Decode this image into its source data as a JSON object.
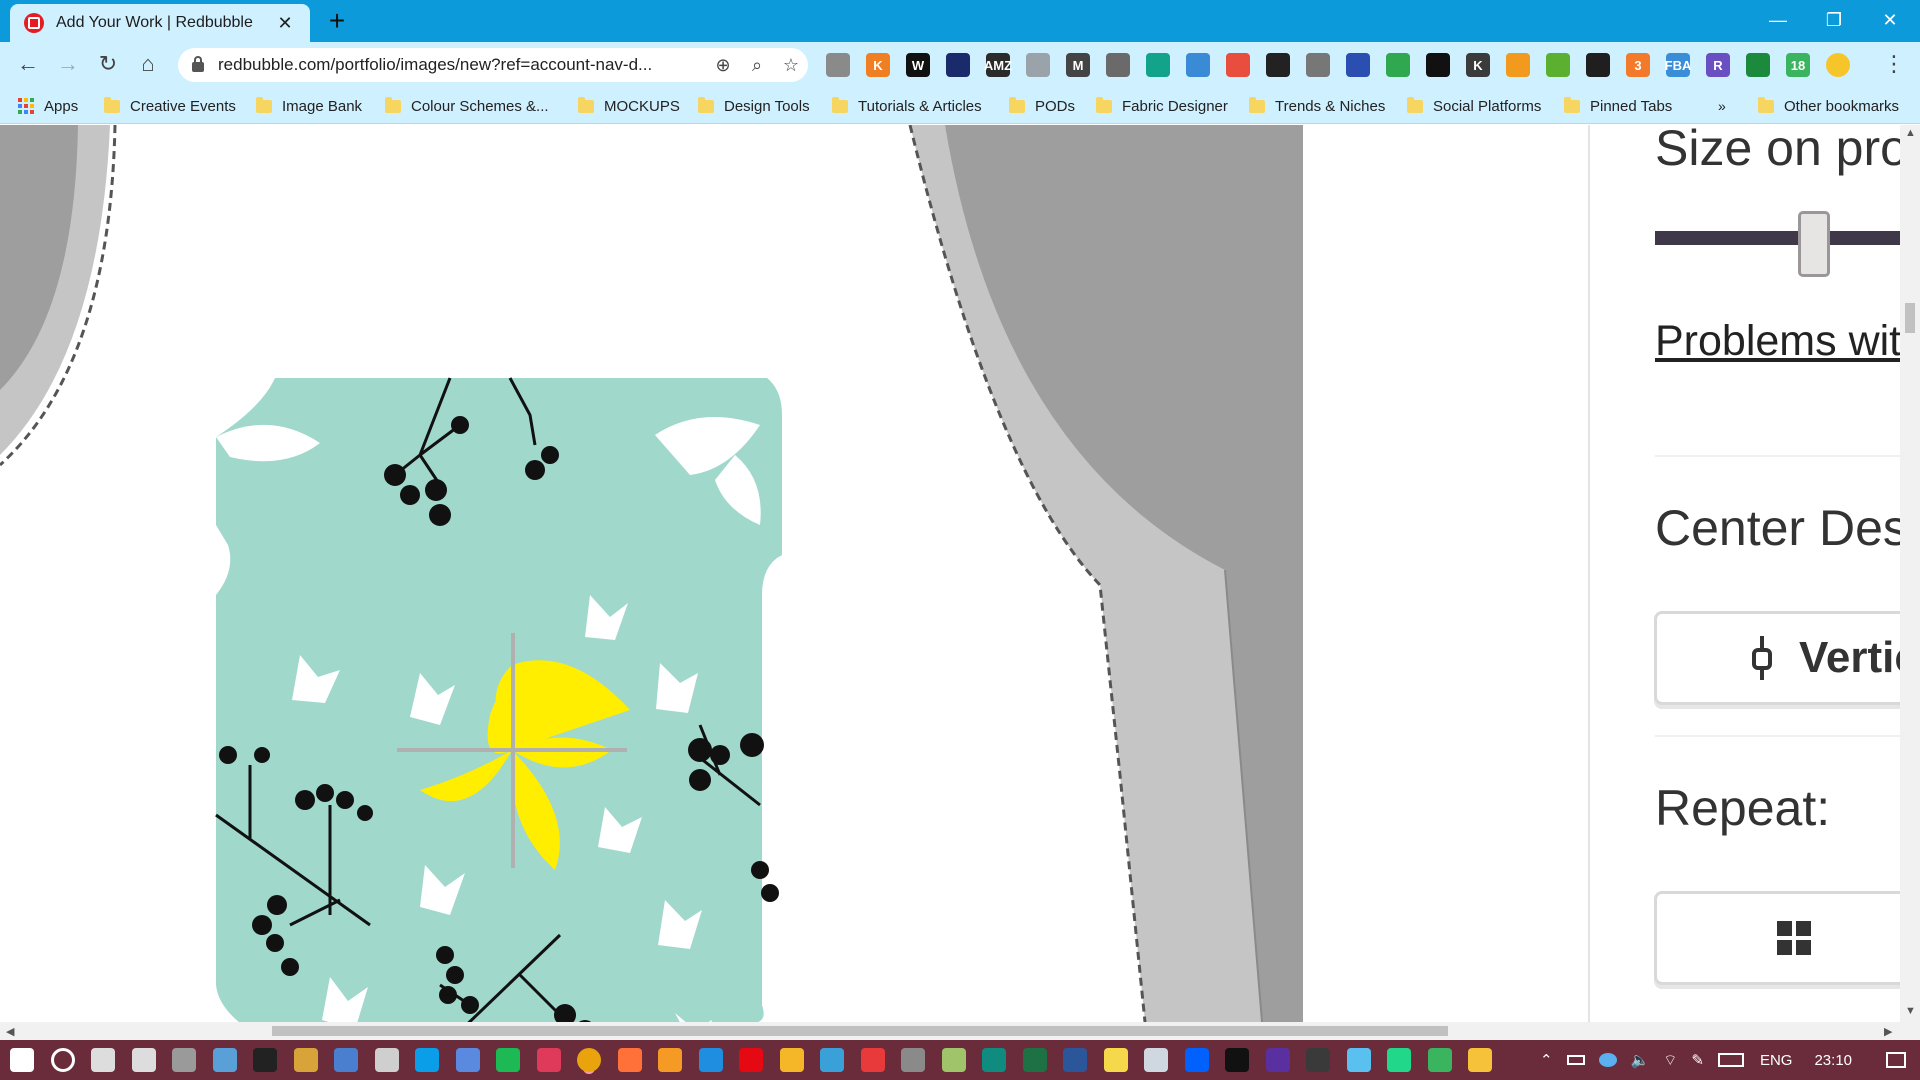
{
  "browser": {
    "tab": {
      "title": "Add Your Work | Redbubble",
      "close": "✕"
    },
    "new_tab": "+",
    "window_controls": {
      "minimize": "—",
      "restore": "❐",
      "close": "✕"
    },
    "nav": {
      "back": "←",
      "forward": "→",
      "reload": "↻",
      "home": "⌂"
    },
    "url": "redbubble.com/portfolio/images/new?ref=account-nav-d...",
    "omnibox_icons": [
      "translate-icon",
      "zoom-icon",
      "bookmark-star-icon"
    ],
    "extensions": [
      {
        "name": "ext-bubble",
        "label": "",
        "color": "#8a8a8a"
      },
      {
        "name": "ext-k",
        "label": "K",
        "color": "#f07f23"
      },
      {
        "name": "ext-w",
        "label": "W",
        "color": "#111111"
      },
      {
        "name": "ext-dark",
        "label": "",
        "color": "#1b2a6b"
      },
      {
        "name": "ext-amz",
        "label": "AMZ",
        "color": "#2b2b2b"
      },
      {
        "name": "ext-expand",
        "label": "",
        "color": "#9aa3aa"
      },
      {
        "name": "ext-m",
        "label": "M",
        "color": "#444444"
      },
      {
        "name": "ext-arrow",
        "label": "",
        "color": "#6a6a6a"
      },
      {
        "name": "ext-teal",
        "label": "",
        "color": "#12a38a"
      },
      {
        "name": "ext-doc",
        "label": "",
        "color": "#3a8ad6"
      },
      {
        "name": "ext-chart",
        "label": "",
        "color": "#e94d3d"
      },
      {
        "name": "ext-circle",
        "label": "",
        "color": "#222222"
      },
      {
        "name": "ext-bar",
        "label": "",
        "color": "#777777"
      },
      {
        "name": "ext-dropper",
        "label": "",
        "color": "#2a4fb0"
      },
      {
        "name": "ext-green-ring",
        "label": "",
        "color": "#2fa84f"
      },
      {
        "name": "ext-sync",
        "label": "",
        "color": "#111111"
      },
      {
        "name": "ext-k-dark",
        "label": "K",
        "color": "#3b3b3b"
      },
      {
        "name": "ext-key",
        "label": "",
        "color": "#f29a1e"
      },
      {
        "name": "ext-green",
        "label": "",
        "color": "#5cb030"
      },
      {
        "name": "ext-term",
        "label": "",
        "color": "#1f1f1f"
      },
      {
        "name": "ext-orange",
        "label": "3",
        "color": "#f27a2a"
      },
      {
        "name": "ext-fba",
        "label": "FBA",
        "color": "#3a8ed8"
      },
      {
        "name": "ext-r",
        "label": "R",
        "color": "#6a4fc2"
      },
      {
        "name": "ext-leaf",
        "label": "",
        "color": "#1c8a3c"
      },
      {
        "name": "ext-badge",
        "label": "18",
        "color": "#3ab45e"
      },
      {
        "name": "profile-avatar",
        "label": "",
        "color": "#f5c52a"
      }
    ],
    "menu": "⋮",
    "bookmarks_overflow": "»",
    "bookmarks": [
      {
        "label": "Apps",
        "type": "apps"
      },
      {
        "label": "Creative Events",
        "type": "folder"
      },
      {
        "label": "Image Bank",
        "type": "folder"
      },
      {
        "label": "Colour Schemes  &...",
        "type": "folder"
      },
      {
        "label": "MOCKUPS",
        "type": "folder"
      },
      {
        "label": "Design Tools",
        "type": "folder"
      },
      {
        "label": "Tutorials & Articles",
        "type": "folder"
      },
      {
        "label": "PODs",
        "type": "folder"
      },
      {
        "label": "Fabric Designer",
        "type": "folder"
      },
      {
        "label": "Trends & Niches",
        "type": "folder"
      },
      {
        "label": "Social Platforms",
        "type": "folder"
      },
      {
        "label": "Pinned Tabs",
        "type": "folder"
      },
      {
        "label": "Other bookmarks",
        "type": "folder"
      }
    ]
  },
  "editor_panel": {
    "size_heading": "Size on pro",
    "size_slider_value": 0.5,
    "problems_link": "Problems wit",
    "center_heading": "Center Des",
    "center_button": "Vertic",
    "repeat_heading": "Repeat:"
  },
  "colors": {
    "chrome_tabstrip": "#0c9ada",
    "chrome_toolbar": "#cff0ff",
    "design_bg": "#a0d8cc",
    "accent_yellow": "#ffee00",
    "taskbar": "#6a2c3b"
  },
  "taskbar": {
    "apps": [
      {
        "name": "windows-start-icon",
        "color": "#ffffff"
      },
      {
        "name": "cortana-icon",
        "color": "#ffffff"
      },
      {
        "name": "settings-icon",
        "color": "#dddddd"
      },
      {
        "name": "timer-icon",
        "color": "#dddddd"
      },
      {
        "name": "app-icon-1",
        "color": "#9a9a9a"
      },
      {
        "name": "app-icon-2",
        "color": "#5aa0d8"
      },
      {
        "name": "cmd-icon",
        "color": "#222222"
      },
      {
        "name": "app-icon-3",
        "color": "#d8a43a"
      },
      {
        "name": "app-icon-4",
        "color": "#4a7fd0"
      },
      {
        "name": "calculator-icon",
        "color": "#cfcfcf"
      },
      {
        "name": "skype-icon",
        "color": "#0a9ee8"
      },
      {
        "name": "app-icon-5",
        "color": "#5a8ae0"
      },
      {
        "name": "spotify-icon",
        "color": "#1db954"
      },
      {
        "name": "app-icon-6",
        "color": "#e03a5a"
      },
      {
        "name": "chrome-icon",
        "color": "#e8a30d"
      },
      {
        "name": "firefox-icon",
        "color": "#ff7139"
      },
      {
        "name": "app-icon-7",
        "color": "#f59a25"
      },
      {
        "name": "edge-icon",
        "color": "#1f8de0"
      },
      {
        "name": "netflix-icon",
        "color": "#e50914"
      },
      {
        "name": "app-icon-8",
        "color": "#f5b728"
      },
      {
        "name": "app-icon-9",
        "color": "#3aa0d8"
      },
      {
        "name": "app-icon-10",
        "color": "#e83a3a"
      },
      {
        "name": "app-icon-11",
        "color": "#8a8a8a"
      },
      {
        "name": "app-icon-12",
        "color": "#a0c46a"
      },
      {
        "name": "sway-icon",
        "color": "#0f8b7f"
      },
      {
        "name": "excel-icon",
        "color": "#1e7145"
      },
      {
        "name": "word-icon",
        "color": "#2b579a"
      },
      {
        "name": "sticky-notes-icon",
        "color": "#f5d94a"
      },
      {
        "name": "app-icon-13",
        "color": "#cfd8e0"
      },
      {
        "name": "dropbox-icon",
        "color": "#0061ff"
      },
      {
        "name": "app-icon-14",
        "color": "#111111"
      },
      {
        "name": "app-icon-15",
        "color": "#5a2fa0"
      },
      {
        "name": "app-icon-16",
        "color": "#3a3a3a"
      },
      {
        "name": "app-icon-17",
        "color": "#5ac0f0"
      },
      {
        "name": "pycharm-icon",
        "color": "#21d789"
      },
      {
        "name": "app-icon-18",
        "color": "#3ab45e"
      },
      {
        "name": "file-explorer-icon",
        "color": "#f5c23a"
      }
    ],
    "language": "ENG",
    "time": "23:10"
  }
}
